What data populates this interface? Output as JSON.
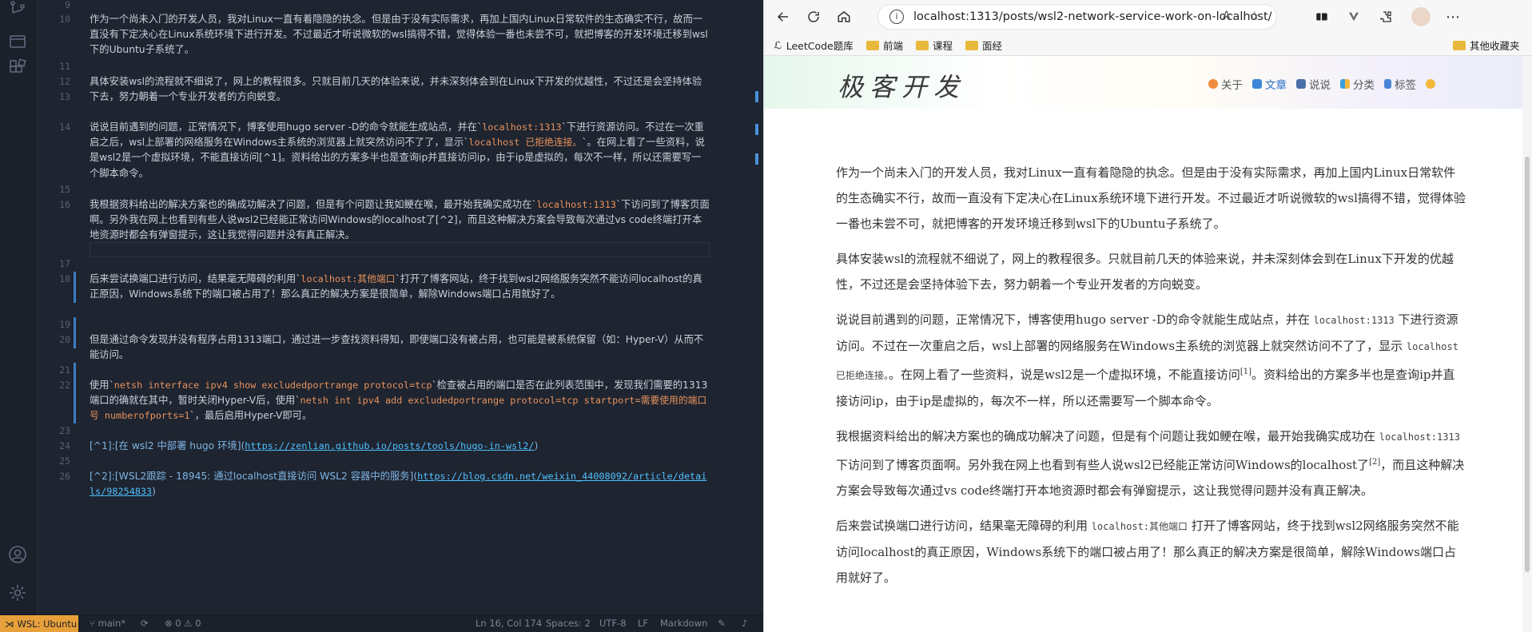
{
  "editor": {
    "line_numbers": [
      "9",
      "10",
      "11",
      "12",
      "13",
      "14",
      "15",
      "16",
      "17",
      "18",
      "19",
      "20",
      "21",
      "22",
      "23",
      "24",
      "25",
      "26"
    ],
    "paragraphs": [
      {
        "ln": "10",
        "text": "作为一个尚未入门的开发人员，我对Linux一直有着隐隐的执念。但是由于没有实际需求，再加上国内Linux日常软件的生态确实不行，故而一直没有下定决心在Linux系统环境下进行开发。不过最近才听说微软的wsl搞得不错，觉得体验一番也未尝不可，就把博客的开发环境迁移到wsl下的Ubuntu子系统了。"
      },
      {
        "ln": "12",
        "text": "具体安装wsl的流程就不细说了，网上的教程很多。只就目前几天的体验来说，并未深刻体会到在Linux下开发的优越性，不过还是会坚持体验下去，努力朝着一个专业开发者的方向蜕变。"
      },
      {
        "ln": "14",
        "pre": "说说目前遇到的问题，正常情况下，博客使用hugo server -D的命令就能生成站点，并在`",
        "code1": "localhost:1313",
        "mid": "`下进行资源访问。不过在一次重启之后，wsl上部署的网络服务在Windows主系统的浏览器上就突然访问不了了，显示`",
        "code2": "localhost 已拒绝连接。",
        "post": "`。在网上看了一些资料，说是wsl2是一个虚拟环境，不能直接访问[^1]。资料给出的方案多半也是查询ip并直接访问ip，由于ip是虚拟的，每次不一样，所以还需要写一个脚本命令。"
      },
      {
        "ln": "16",
        "pre": "我根据资料给出的解决方案也的确成功解决了问题，但是有个问题让我如鲠在喉，最开始我确实成功在`",
        "code1": "localhost:1313",
        "post": "`下访问到了博客页面啊。另外我在网上也看到有些人说wsl2已经能正常访问Windows的localhost了[^2]，而且这种解决方案会导致每次通过vs code终端打开本地资源时都会有弹窗提示，这让我觉得问题并没有真正解决。"
      },
      {
        "ln": "18",
        "pre": "后来尝试换端口进行访问，结果毫无障碍的利用`",
        "code1": "localhost:其他端口",
        "post": "`打开了博客网站，终于找到wsl2网络服务突然不能访问localhost的真正原因，Windows系统下的端口被占用了！那么真正的解决方案是很简单，解除Windows端口占用就好了。"
      },
      {
        "ln": "20",
        "text": "但是通过命令发现并没有程序占用1313端口，通过进一步查找资料得知，即使端口没有被占用，也可能是被系统保留（如：Hyper-V）从而不能访问。"
      },
      {
        "ln": "22",
        "pre": "使用`",
        "code1": "netsh interface ipv4 show excludedportrange protocol=tcp",
        "mid": "`检查被占用的端口是否在此列表范围中，发现我们需要的1313端口的确就在其中，暂时关闭Hyper-V后，使用`",
        "code2": "netsh int ipv4 add excludedportrange protocol=tcp startport=需要使用的端口号 numberofports=1",
        "post": "`，最后启用Hyper-V即可。"
      },
      {
        "ln": "24",
        "label": "[^1]:[在 wsl2 中部署 hugo 环境](",
        "url": "https://zenlian.github.io/posts/tools/hugo-in-wsl2/",
        "close": ")"
      },
      {
        "ln": "26",
        "label": "[^2]:[WSL2跟踪 - 18945: 通过localhost直接访问 WSL2 容器中的服务](",
        "url": "https://blog.csdn.net/weixin_44008092/article/details/98254833",
        "close": ")"
      }
    ]
  },
  "statusbar": {
    "wsl": "WSL: Ubuntu",
    "branch": "main*",
    "problems": "⊗ 0 ⚠ 0",
    "position": "Ln 16, Col 174",
    "spaces": "Spaces: 2",
    "encoding": "UTF-8",
    "eol": "LF",
    "language": "Markdown"
  },
  "browser": {
    "url": "localhost:1313/posts/wsl2-network-service-work-on-localhost/",
    "bookmarks": [
      "LeetCode题库",
      "前端",
      "课程",
      "面经"
    ],
    "other_bookmarks": "其他收藏夹"
  },
  "blog": {
    "logo": "极客开发",
    "nav": [
      "关于",
      "文章",
      "说说",
      "分类",
      "标签"
    ],
    "paragraphs": [
      {
        "text": "作为一个尚未入门的开发人员，我对Linux一直有着隐隐的执念。但是由于没有实际需求，再加上国内Linux日常软件的生态确实不行，故而一直没有下定决心在Linux系统环境下进行开发。不过最近才听说微软的wsl搞得不错，觉得体验一番也未尝不可，就把博客的开发环境迁移到wsl下的Ubuntu子系统了。"
      },
      {
        "text": "具体安装wsl的流程就不细说了，网上的教程很多。只就目前几天的体验来说，并未深刻体会到在Linux下开发的优越性，不过还是会坚持体验下去，努力朝着一个专业开发者的方向蜕变。"
      },
      {
        "pre": "说说目前遇到的问题，正常情况下，博客使用hugo server -D的命令就能生成站点，并在 ",
        "code1": "localhost:1313",
        "mid": " 下进行资源访问。不过在一次重启之后，wsl上部署的网络服务在Windows主系统的浏览器上就突然访问不了了，显示 ",
        "code2": "localhost 已拒绝连接。",
        "post": "。在网上看了一些资料，说是wsl2是一个虚拟环境，不能直接访问",
        "sup": "[1]",
        "post2": "。资料给出的方案多半也是查询ip并直接访问ip，由于ip是虚拟的，每次不一样，所以还需要写一个脚本命令。"
      },
      {
        "pre": "我根据资料给出的解决方案也的确成功解决了问题，但是有个问题让我如鲠在喉，最开始我确实成功在 ",
        "code1": "localhost:1313",
        "mid": " 下访问到了博客页面啊。另外我在网上也看到有些人说wsl2已经能正常访问Windows的localhost了",
        "sup": "[2]",
        "post": "，而且这种解决方案会导致每次通过vs code终端打开本地资源时都会有弹窗提示，这让我觉得问题并没有真正解决。"
      },
      {
        "pre": "后来尝试换端口进行访问，结果毫无障碍的利用 ",
        "code1": "localhost:其他端口",
        "post": " 打开了博客网站，终于找到wsl2网络服务突然不能访问localhost的真正原因，Windows系统下的端口被占用了！那么真正的解决方案是很简单，解除Windows端口占用就好了。"
      }
    ]
  }
}
